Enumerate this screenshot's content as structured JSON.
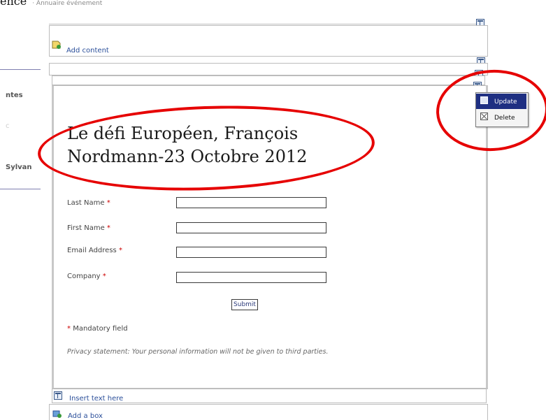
{
  "breadcrumb": {
    "first": "ence",
    "rest": "· Annuaire événement"
  },
  "sidebar": {
    "items": [
      {
        "label": "ntes"
      },
      {
        "label": "Sylvan"
      }
    ],
    "faint": "c"
  },
  "zones": {
    "add_content": "Add content",
    "insert_text": "Insert text here",
    "add_box": "Add a box"
  },
  "context_menu": {
    "items": [
      {
        "label": "Update",
        "icon": "document-icon",
        "highlighted": true
      },
      {
        "label": "Delete",
        "icon": "delete-x-icon",
        "highlighted": false
      }
    ]
  },
  "content": {
    "title_line1": "Le défi Européen, François",
    "title_line2": "Nordmann-23 Octobre 2012"
  },
  "form": {
    "fields": [
      {
        "label": "Last Name",
        "required_marker": "*",
        "value": ""
      },
      {
        "label": "First Name",
        "required_marker": "*",
        "value": ""
      },
      {
        "label": "Email Address",
        "required_marker": "*",
        "value": ""
      },
      {
        "label": "Company",
        "required_marker": "*",
        "value": ""
      }
    ],
    "submit_label": "Submit",
    "mandatory_marker": "*",
    "mandatory_text": "Mandatory field",
    "privacy": "Privacy statement: Your personal information will not be given to third parties."
  },
  "colors": {
    "annotation_red": "#e60000",
    "menu_highlight": "#1e2f82",
    "link_blue": "#2b4f9a"
  }
}
